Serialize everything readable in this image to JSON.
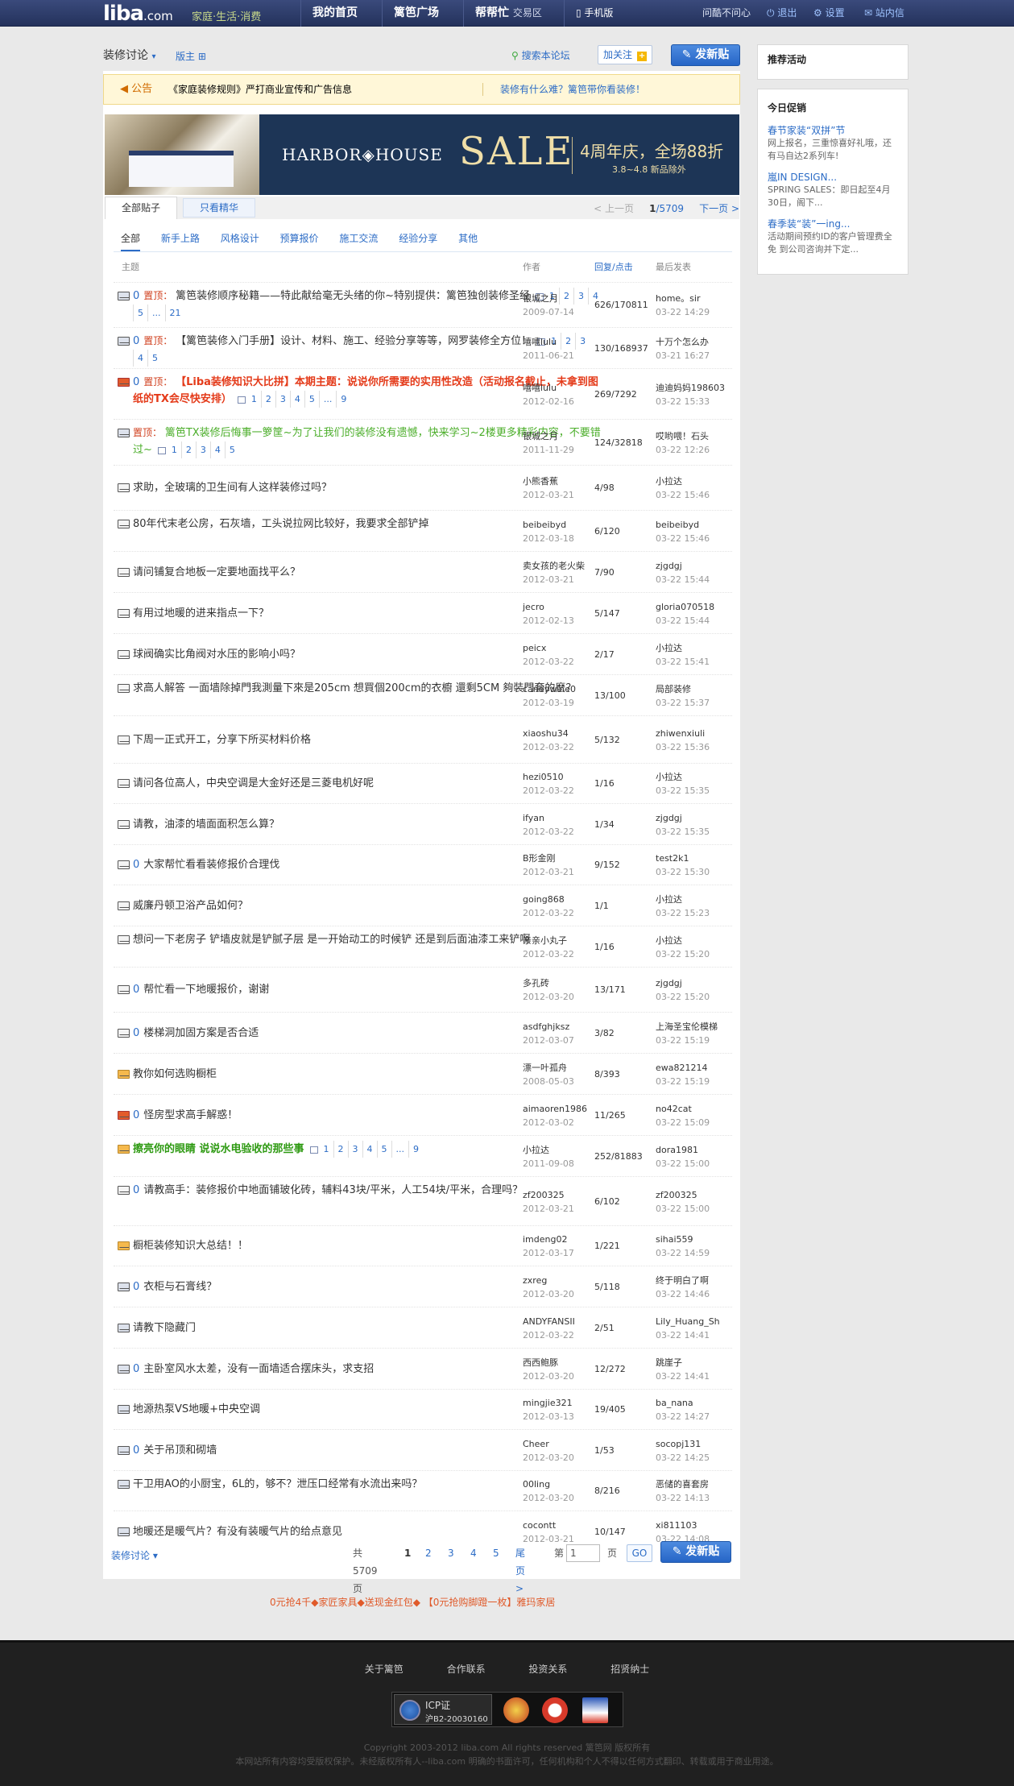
{
  "topbar": {
    "logo": "liba",
    "logo_suffix": ".com",
    "slogan": "家庭·生活·消费",
    "nav": [
      {
        "label": "我的首页"
      },
      {
        "label": "篱笆广场"
      },
      {
        "label": "帮帮忙",
        "sub": "交易区"
      },
      {
        "label": "手机版"
      }
    ],
    "user": "问酷不问心",
    "logout": "退出",
    "settings": "设置",
    "messages": "站内信"
  },
  "forum": {
    "title": "装修讨论",
    "moderator": "版主",
    "search_link": "搜索本论坛",
    "follow": "加关注",
    "post_button": "发新贴"
  },
  "notice": {
    "label": "公告",
    "text1": "《家庭装修规则》严打商业宣传和广告信息",
    "text2": "装修有什么难？篱笆带你看装修！"
  },
  "banner": {
    "brand": "HARBOR◈HOUSE",
    "sale": "SALE",
    "promo": "4周年庆，全场88折",
    "date": "3.8~4.8  新品除外"
  },
  "tabs": {
    "all": "全部贴子",
    "digest": "只看精华",
    "prev": "< 上一页",
    "page": "1",
    "total_pages": "/5709",
    "next": "下一页 >"
  },
  "subnav": [
    "全部",
    "新手上路",
    "风格设计",
    "预算报价",
    "施工交流",
    "经验分享",
    "其他"
  ],
  "table_header": {
    "topic": "主题",
    "author": "作者",
    "reply_click": "回复/点击",
    "last": "最后发表"
  },
  "threads": [
    {
      "icon": "multi",
      "prefix": "0",
      "top": "置顶：",
      "title": "篱笆装修顺序秘籍——特此献给毫无头绪的你~特别提供：篱笆独创装修圣经",
      "pages": [
        "1",
        "2",
        "3",
        "4",
        "5",
        "...",
        "21"
      ],
      "author": "银城之月",
      "adate": "2009-07-14",
      "rc": "626/170811",
      "last": "home。sir",
      "ldate": "03-22 14:29"
    },
    {
      "icon": "multi",
      "prefix": "0",
      "top": "置顶：",
      "title": "【篱笆装修入门手册】设计、材料、施工、经验分享等等，网罗装修全方位！",
      "pages": [
        "1",
        "2",
        "3",
        "4",
        "5"
      ],
      "author": "嘻嘻lulu",
      "adate": "2011-06-21",
      "rc": "130/168937",
      "last": "十万个怎么办",
      "ldate": "03-21 16:27"
    },
    {
      "icon": "red",
      "prefix": "0",
      "top": "置顶：",
      "title": "【Liba装修知识大比拼】本期主题：说说你所需要的实用性改造（活动报名截止，未拿到图纸的TX会尽快安排）",
      "style": "red",
      "pages": [
        "1",
        "2",
        "3",
        "4",
        "5",
        "...",
        "9"
      ],
      "author": "嘻嘻lulu",
      "adate": "2012-02-16",
      "rc": "269/7292",
      "last": "迪迪妈妈198603",
      "ldate": "03-22 15:33"
    },
    {
      "icon": "multi",
      "prefix": "",
      "top": "置顶：",
      "title": "篱笆TX装修后悔事一箩筐~为了让我们的装修没有遗憾，快来学习~2楼更多精彩内容，不要错过~",
      "style": "green",
      "pages": [
        "1",
        "2",
        "3",
        "4",
        "5"
      ],
      "author": "银城之月",
      "adate": "2011-11-29",
      "rc": "124/32818",
      "last": "哎哟喂！石头",
      "ldate": "03-22 12:26"
    },
    {
      "icon": "normal",
      "prefix": "",
      "title": "求助，全玻璃的卫生间有人这样装修过吗？",
      "author": "小熊香蕉",
      "adate": "2012-03-21",
      "rc": "4/98",
      "last": "小拉达",
      "ldate": "03-22 15:46"
    },
    {
      "icon": "normal",
      "prefix": "",
      "title": "80年代末老公房，石灰墙，工头说拉网比较好，我要求全部铲掉",
      "author": "beibeibyd",
      "adate": "2012-03-18",
      "rc": "6/120",
      "last": "beibeibyd",
      "ldate": "03-22 15:46"
    },
    {
      "icon": "normal",
      "prefix": "",
      "title": "请问铺复合地板一定要地面找平么？",
      "author": "卖女孩的老火柴",
      "adate": "2012-03-21",
      "rc": "7/90",
      "last": "zjgdgj",
      "ldate": "03-22 15:44"
    },
    {
      "icon": "normal",
      "prefix": "",
      "title": "有用过地暖的进来指点一下？",
      "author": "jecro",
      "adate": "2012-02-13",
      "rc": "5/147",
      "last": "gloria070518",
      "ldate": "03-22 15:44"
    },
    {
      "icon": "normal",
      "prefix": "",
      "title": "球阀确实比角阀对水压的影响小吗？",
      "author": "peicx",
      "adate": "2012-03-22",
      "rc": "2/17",
      "last": "小拉达",
      "ldate": "03-22 15:41"
    },
    {
      "icon": "normal",
      "prefix": "",
      "title": "求高人解答 一面墙除掉門我測量下來是205cm 想買個200cm的衣櫥 還剩5CM 夠裝門套的麽？",
      "author": "candywine0",
      "adate": "2012-03-19",
      "rc": "13/100",
      "last": "局部装修",
      "ldate": "03-22 15:37"
    },
    {
      "icon": "normal",
      "prefix": "",
      "title": "下周一正式开工，分享下所买材料价格",
      "author": "xiaoshu34",
      "adate": "2012-03-22",
      "rc": "5/132",
      "last": "zhiwenxiuli",
      "ldate": "03-22 15:36"
    },
    {
      "icon": "normal",
      "prefix": "",
      "title": "请问各位高人，中央空调是大金好还是三菱电机好呢",
      "author": "hezi0510",
      "adate": "2012-03-22",
      "rc": "1/16",
      "last": "小拉达",
      "ldate": "03-22 15:35"
    },
    {
      "icon": "normal",
      "prefix": "",
      "title": "请教，油漆的墙面面积怎么算？",
      "author": "ifyan",
      "adate": "2012-03-22",
      "rc": "1/34",
      "last": "zjgdgj",
      "ldate": "03-22 15:35"
    },
    {
      "icon": "normal",
      "prefix": "0",
      "title": "大家帮忙看看装修报价合理伐",
      "author": "B形金刚",
      "adate": "2012-03-21",
      "rc": "9/152",
      "last": "test2k1",
      "ldate": "03-22 15:30"
    },
    {
      "icon": "normal",
      "prefix": "",
      "title": "威廉丹顿卫浴产品如何？",
      "author": "going868",
      "adate": "2012-03-22",
      "rc": "1/1",
      "last": "小拉达",
      "ldate": "03-22 15:23"
    },
    {
      "icon": "normal",
      "prefix": "",
      "title": "想问一下老房子 铲墙皮就是铲腻子层 是一开始动工的时候铲 还是到后面油漆工来铲啊",
      "author": "亲亲小丸子",
      "adate": "2012-03-22",
      "rc": "1/16",
      "last": "小拉达",
      "ldate": "03-22 15:20"
    },
    {
      "icon": "normal",
      "prefix": "0",
      "title": "帮忙看一下地暖报价，谢谢",
      "author": "多孔砖",
      "adate": "2012-03-20",
      "rc": "13/171",
      "last": "zjgdgj",
      "ldate": "03-22 15:20"
    },
    {
      "icon": "normal",
      "prefix": "0",
      "title": "楼梯洞加固方案是否合适",
      "author": "asdfghjksz",
      "adate": "2012-03-07",
      "rc": "3/82",
      "last": "上海圣宝伦模梯",
      "ldate": "03-22 15:19"
    },
    {
      "icon": "orange",
      "prefix": "",
      "title": "教你如何选购橱柜",
      "author": "漂一叶孤舟",
      "adate": "2008-05-03",
      "rc": "8/393",
      "last": "ewa821214",
      "ldate": "03-22 15:19"
    },
    {
      "icon": "red",
      "prefix": "0",
      "title": "怪房型求高手解惑！",
      "author": "aimaoren1986",
      "adate": "2012-03-02",
      "rc": "11/265",
      "last": "no42cat",
      "ldate": "03-22 15:09"
    },
    {
      "icon": "green",
      "prefix": "",
      "title": "擦亮你的眼睛 说说水电验收的那些事",
      "style": "greenb",
      "pages": [
        "1",
        "2",
        "3",
        "4",
        "5",
        "...",
        "9"
      ],
      "author": "小拉达",
      "adate": "2011-09-08",
      "rc": "252/81883",
      "last": "dora1981",
      "ldate": "03-22 15:00"
    },
    {
      "icon": "normal",
      "prefix": "0",
      "title": "请教高手：装修报价中地面铺玻化砖，辅料43块/平米，人工54块/平米，合理吗？",
      "author": "zf200325",
      "adate": "2012-03-21",
      "rc": "6/102",
      "last": "zf200325",
      "ldate": "03-22 15:00"
    },
    {
      "icon": "orange",
      "prefix": "",
      "title": "橱柜装修知识大总结！！",
      "author": "imdeng02",
      "adate": "2012-03-17",
      "rc": "1/221",
      "last": "sihai559",
      "ldate": "03-22 14:59"
    },
    {
      "icon": "multi",
      "prefix": "0",
      "title": "衣柜与石膏线？",
      "author": "zxreg",
      "adate": "2012-03-20",
      "rc": "5/118",
      "last": "终于明白了啊",
      "ldate": "03-22 14:46"
    },
    {
      "icon": "multi",
      "prefix": "",
      "title": "请教下隐藏门",
      "author": "ANDYFANSII",
      "adate": "2012-03-22",
      "rc": "2/51",
      "last": "Lily_Huang_Sh",
      "ldate": "03-22 14:41"
    },
    {
      "icon": "multi",
      "prefix": "0",
      "title": "主卧室风水太差，没有一面墙适合摆床头，求支招",
      "author": "西西鲍豚",
      "adate": "2012-03-20",
      "rc": "12/272",
      "last": "跳崖子",
      "ldate": "03-22 14:41"
    },
    {
      "icon": "multi",
      "prefix": "",
      "title": "地源热泵VS地暖+中央空调",
      "author": "mingjie321",
      "adate": "2012-03-13",
      "rc": "19/405",
      "last": "ba_nana",
      "ldate": "03-22 14:27"
    },
    {
      "icon": "multi",
      "prefix": "0",
      "title": "关于吊顶和砌墙",
      "author": "Cheer",
      "adate": "2012-03-20",
      "rc": "1/53",
      "last": "socopj131",
      "ldate": "03-22 14:25"
    },
    {
      "icon": "multi",
      "prefix": "",
      "title": "干卫用AO的小厨宝，6L的，够不？泄压口经常有水流出来吗？",
      "author": "00ling",
      "adate": "2012-03-20",
      "rc": "8/216",
      "last": "恶储的喜套房",
      "ldate": "03-22 14:13"
    },
    {
      "icon": "multi",
      "prefix": "",
      "title": "地暖还是暖气片？有没有装暖气片的给点意见",
      "author": "cocontt",
      "adate": "2012-03-21",
      "rc": "10/147",
      "last": "xi811103",
      "ldate": "03-22 14:08"
    }
  ],
  "bottom": {
    "forum_menu": "装修讨论",
    "total": "共5709页",
    "pages": [
      "1",
      "2",
      "3",
      "4",
      "5"
    ],
    "last_page": "尾页 >",
    "goto_pre": "第",
    "goto_val": "1",
    "goto_post": "页",
    "go": "GO",
    "post_button": "发新贴"
  },
  "promo": "0元抢4千◆家匠家具◆送现金红包◆    【0元抢购脚蹬一枚】雅玛家居",
  "sidebar": {
    "recommend_title": "推荐活动",
    "today_title": "今日促销",
    "items": [
      {
        "title": "春节家装“双拼”节",
        "desc": "网上报名，三重惊喜好礼哦，还有马自达2系列车!"
      },
      {
        "title": "嵐IN DESIGN...",
        "desc": "SPRING SALES：即日起至4月30日，阁下..."
      },
      {
        "title": "春季装“装”一ing...",
        "desc": "活动期间预约ID的客户管理费全免 到公司咨询并下定..."
      }
    ]
  },
  "footer": {
    "links": [
      "关于篱笆",
      "合作联系",
      "投资关系",
      "招贤纳士"
    ],
    "icp1": "ICP证",
    "icp2": "沪B2-20030160",
    "copyright": "Copyright 2003-2012 liba.com All rights reserved 篱笆网 版权所有",
    "notice": "本网站所有内容均受版权保护。未经版权所有人--liba.com 明确的书面许可，任何机构和个人不得以任何方式翻印、转载或用于商业用途。"
  },
  "colors": {
    "topbar": "#2d3c6c",
    "accent": "#2c6cc6",
    "top_red": "#d0401f",
    "promo": "#e05a2a"
  }
}
